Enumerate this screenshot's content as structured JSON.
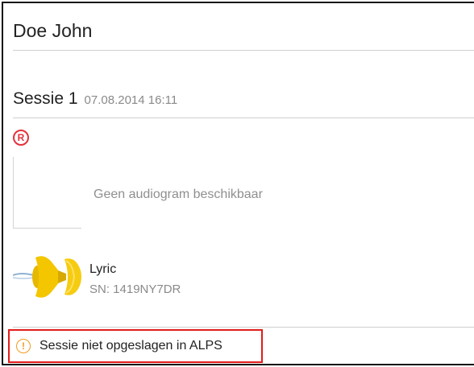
{
  "patient": {
    "name": "Doe John"
  },
  "session": {
    "title": "Sessie 1",
    "date": "07.08.2014 16:11"
  },
  "badge": {
    "symbol": "R",
    "color": "#e3323b"
  },
  "audiogram": {
    "empty_text": "Geen audiogram beschikbaar"
  },
  "device": {
    "name": "Lyric",
    "serial": "SN: 1419NY7DR",
    "image_icon": "hearing-aid-icon"
  },
  "warning": {
    "symbol": "!",
    "text": "Sessie niet opgeslagen in ALPS",
    "icon_color": "#f29b1d",
    "border_color": "#e21b1b"
  }
}
